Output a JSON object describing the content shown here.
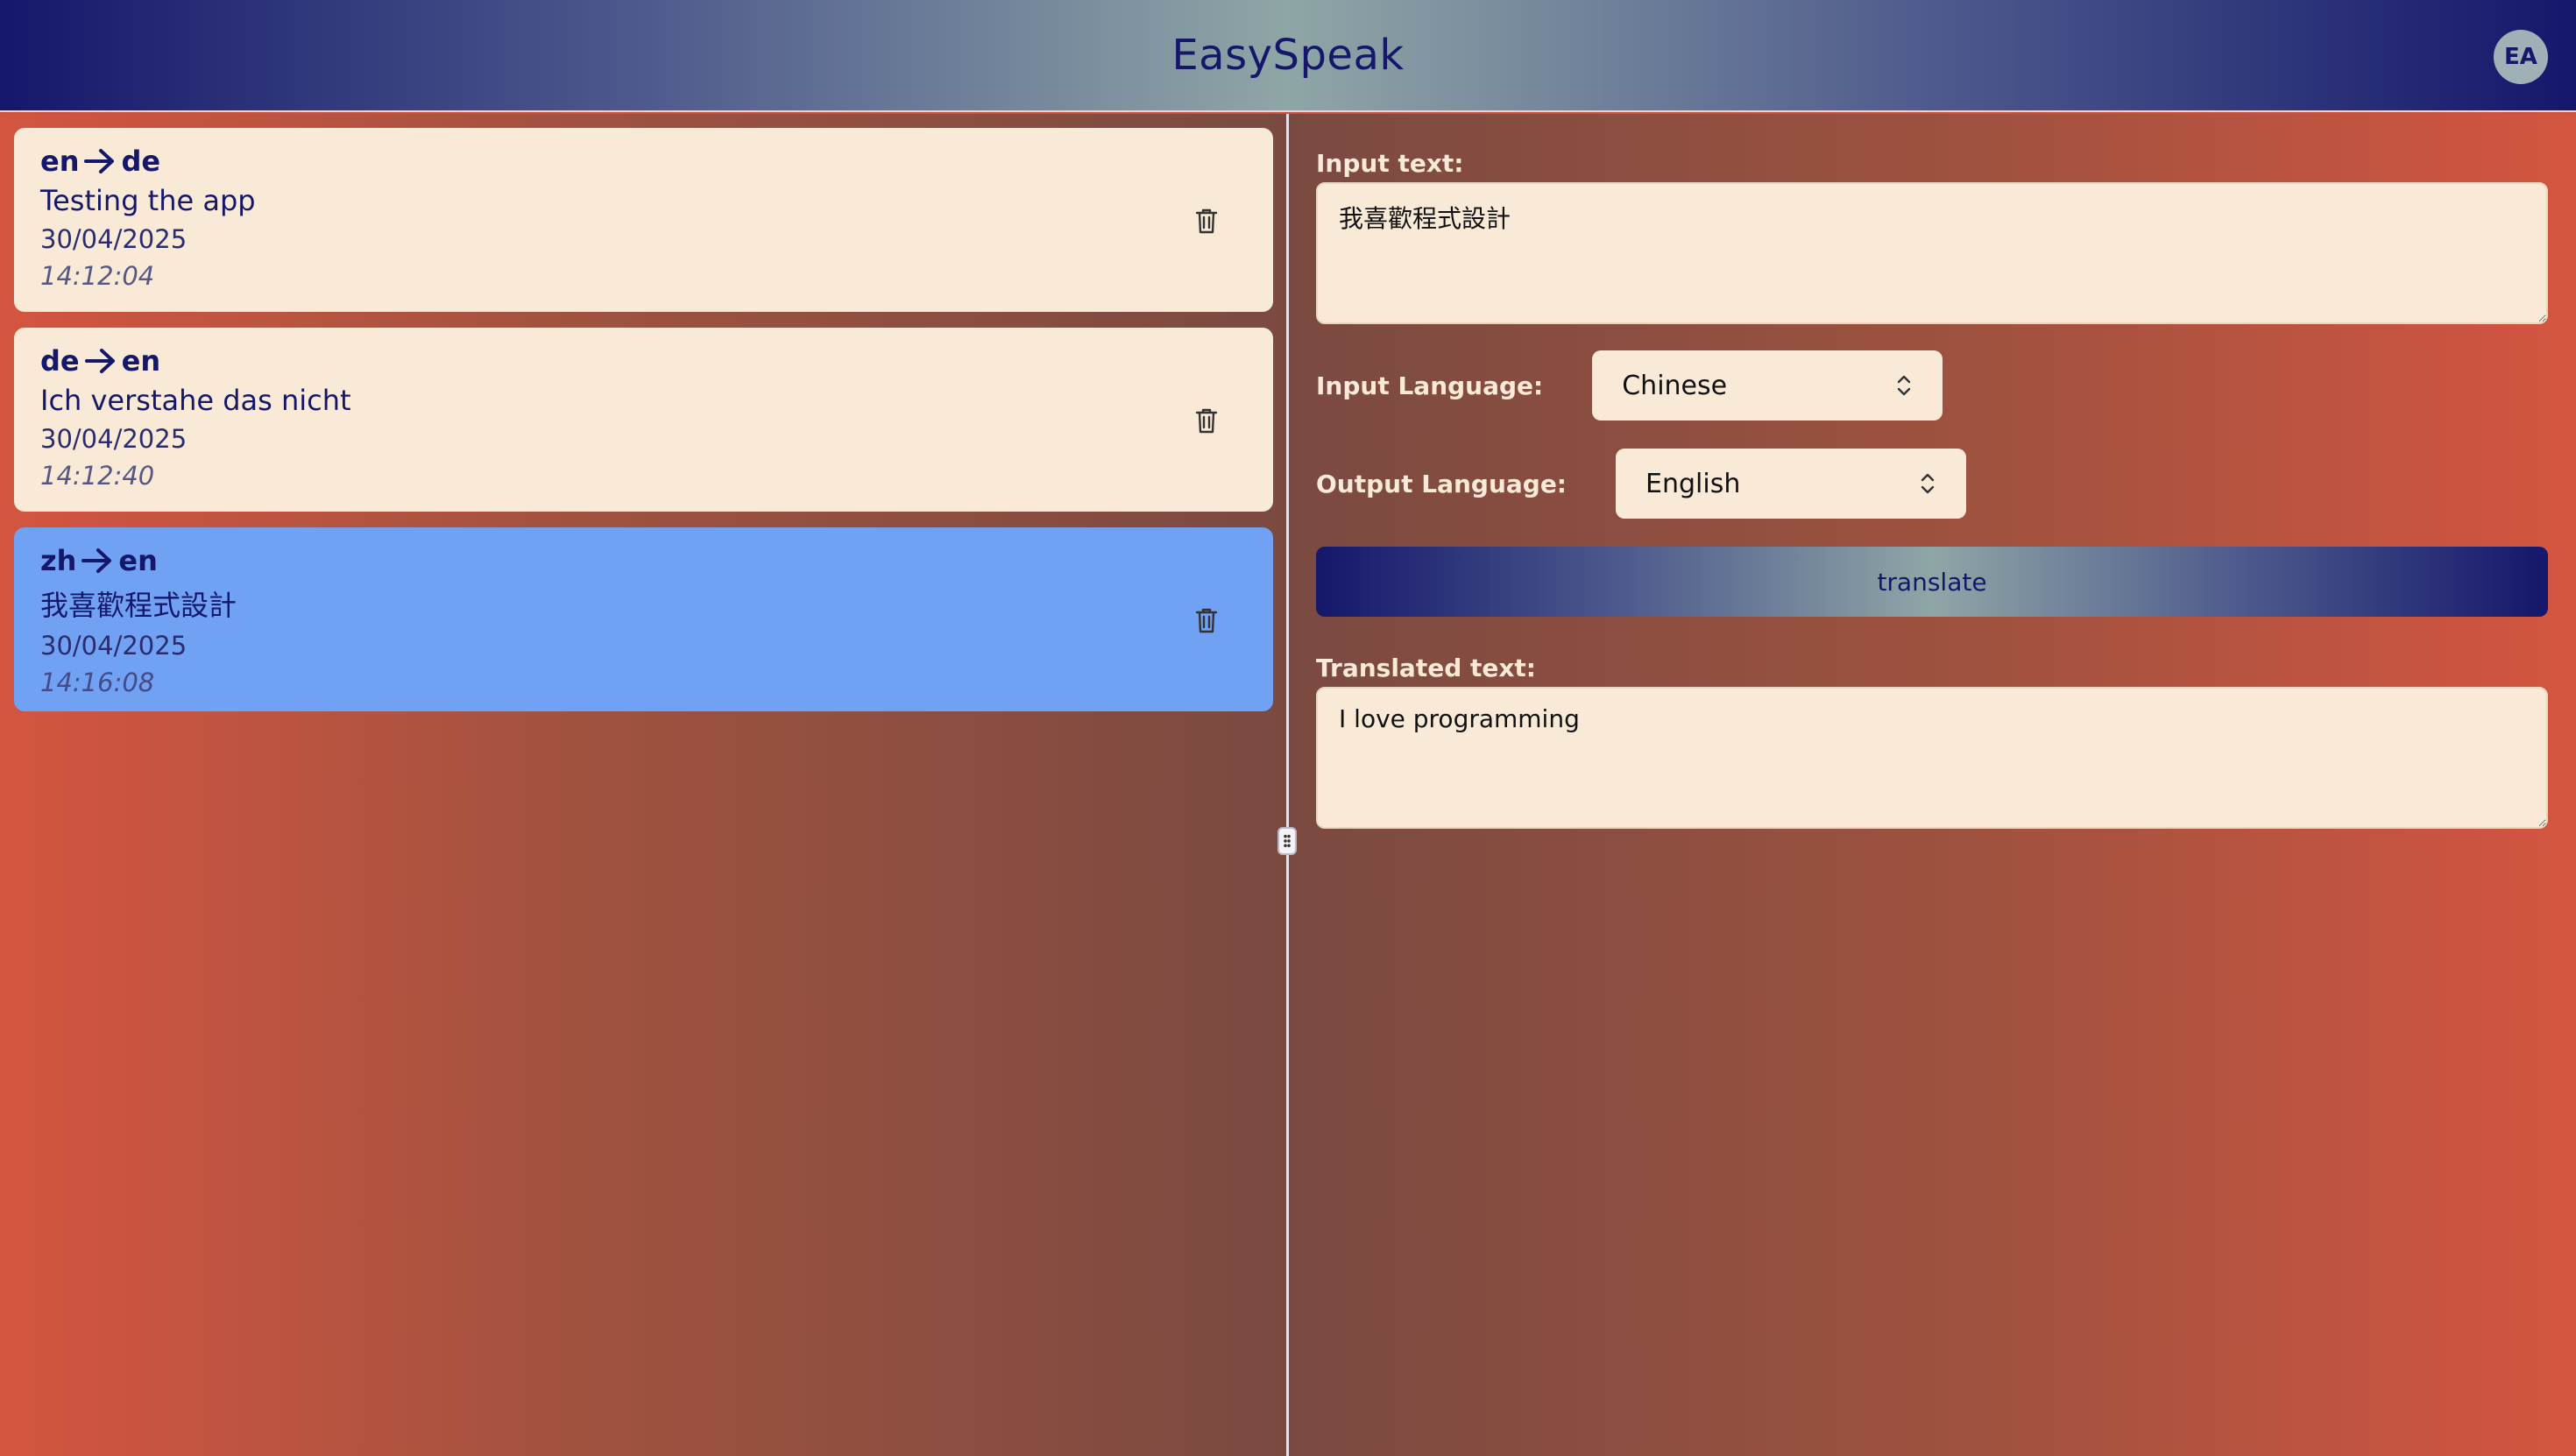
{
  "header": {
    "title": "EasySpeak",
    "avatar_initials": "EA"
  },
  "history": [
    {
      "from": "en",
      "to": "de",
      "text": "Testing the app",
      "date": "30/04/2025",
      "time": "14:12:04",
      "selected": false
    },
    {
      "from": "de",
      "to": "en",
      "text": "Ich verstahe das nicht",
      "date": "30/04/2025",
      "time": "14:12:40",
      "selected": false
    },
    {
      "from": "zh",
      "to": "en",
      "text": "我喜歡程式設計",
      "date": "30/04/2025",
      "time": "14:16:08",
      "selected": true
    }
  ],
  "form": {
    "input_label": "Input text:",
    "input_value": "我喜歡程式設計",
    "input_language_label": "Input Language:",
    "input_language_value": "Chinese",
    "output_language_label": "Output Language:",
    "output_language_value": "English",
    "translate_label": "translate",
    "translated_label": "Translated text:",
    "translated_value": "I love programming"
  },
  "colors": {
    "navy": "#15176b",
    "card_bg": "#f8ead6",
    "selected_card": "#71a1f3",
    "background_warm": "#d45540"
  },
  "icons": {
    "delete": "trash-icon",
    "arrow": "arrow-right-icon",
    "select": "chevron-up-down-icon",
    "divider": "drag-handle-icon"
  }
}
